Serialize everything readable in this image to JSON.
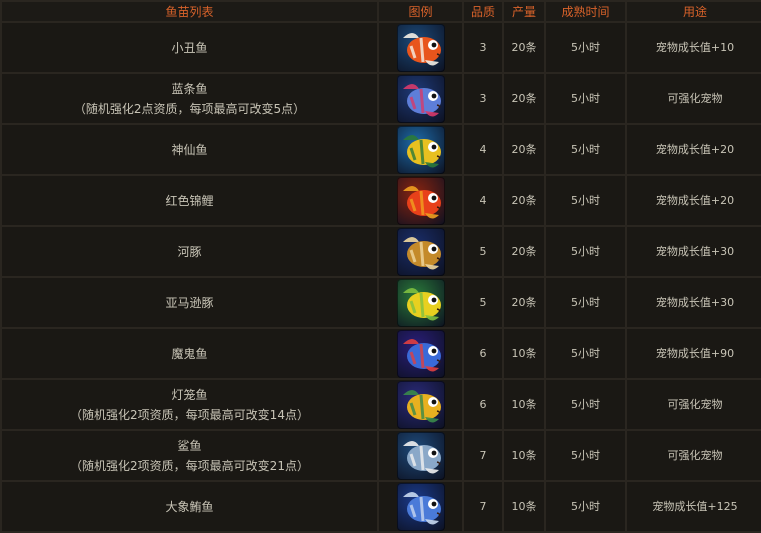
{
  "headers": [
    "鱼苗列表",
    "图例",
    "品质",
    "产量",
    "成熟时间",
    "用途"
  ],
  "rows": [
    {
      "name": "小丑鱼",
      "note": "",
      "icon": "clownfish-icon",
      "bg": "#1b4a7a",
      "body": "#e8551c",
      "fin": "#f4f0e6",
      "quality": "3",
      "yield": "20条",
      "time": "5小时",
      "use": "宠物成长值+10"
    },
    {
      "name": "蓝条鱼",
      "note": "（随机强化2点资质，每项最高可改变5点）",
      "icon": "blue-striped-fish-icon",
      "bg": "#1e3a78",
      "body": "#5e7ed8",
      "fin": "#d83a6a",
      "quality": "3",
      "yield": "20条",
      "time": "5小时",
      "use": "可强化宠物"
    },
    {
      "name": "神仙鱼",
      "note": "",
      "icon": "angelfish-icon",
      "bg": "#1d6aa8",
      "body": "#e8c020",
      "fin": "#2b7a3a",
      "quality": "4",
      "yield": "20条",
      "time": "5小时",
      "use": "宠物成长值+20"
    },
    {
      "name": "红色锦鲤",
      "note": "",
      "icon": "red-koi-icon",
      "bg": "#8a2410",
      "body": "#e8401a",
      "fin": "#f0a020",
      "quality": "4",
      "yield": "20条",
      "time": "5小时",
      "use": "宠物成长值+20"
    },
    {
      "name": "河豚",
      "note": "",
      "icon": "pufferfish-icon",
      "bg": "#1a2e6a",
      "body": "#c48a2a",
      "fin": "#f0d8a0",
      "quality": "5",
      "yield": "20条",
      "time": "5小时",
      "use": "宠物成长值+30"
    },
    {
      "name": "亚马逊豚",
      "note": "",
      "icon": "amazon-puffer-icon",
      "bg": "#2a7a3a",
      "body": "#e8d020",
      "fin": "#80c040",
      "quality": "5",
      "yield": "20条",
      "time": "5小时",
      "use": "宠物成长值+30"
    },
    {
      "name": "魔鬼鱼",
      "note": "",
      "icon": "devil-ray-icon",
      "bg": "#2a1e7a",
      "body": "#3a6ad8",
      "fin": "#e04040",
      "quality": "6",
      "yield": "10条",
      "time": "5小时",
      "use": "宠物成长值+90"
    },
    {
      "name": "灯笼鱼",
      "note": "（随机强化2项资质，每项最高可改变14点）",
      "icon": "lanternfish-icon",
      "bg": "#2a2a7a",
      "body": "#e8b020",
      "fin": "#3a8a4a",
      "quality": "6",
      "yield": "10条",
      "time": "5小时",
      "use": "可强化宠物"
    },
    {
      "name": "鲨鱼",
      "note": "（随机强化2项资质，每项最高可改变21点）",
      "icon": "shark-icon",
      "bg": "#1e4a7a",
      "body": "#8aa8c8",
      "fin": "#f0f0f0",
      "quality": "7",
      "yield": "10条",
      "time": "5小时",
      "use": "可强化宠物"
    },
    {
      "name": "大象鲔鱼",
      "note": "",
      "icon": "elephant-tuna-icon",
      "bg": "#1a3a8a",
      "body": "#4a7ad8",
      "fin": "#c8d8f0",
      "quality": "7",
      "yield": "10条",
      "time": "5小时",
      "use": "宠物成长值+125"
    }
  ]
}
